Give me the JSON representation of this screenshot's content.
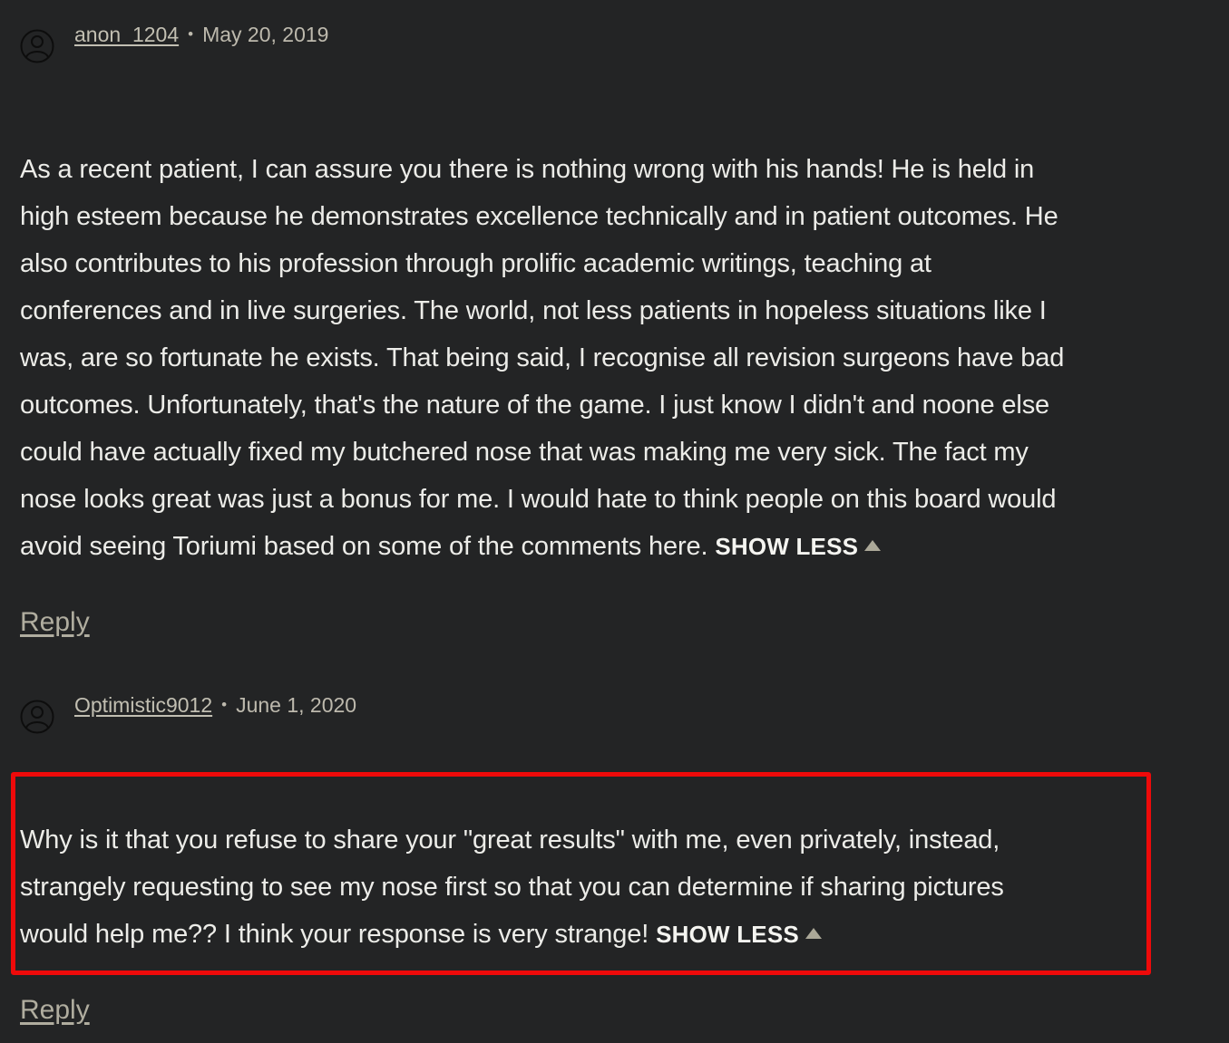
{
  "comments": [
    {
      "author": "anon_1204",
      "separator": "•",
      "date": "May 20, 2019",
      "lines": [
        "As a recent patient, I can assure you there is nothing wrong with his hands! He is held in",
        "high esteem because he demonstrates excellence technically and in patient outcomes. He",
        "also contributes to his profession through prolific academic writings, teaching at",
        "conferences and in live surgeries. The world, not less patients in hopeless situations like I",
        "was, are so fortunate he exists. That being said, I recognise all revision surgeons have bad",
        "outcomes. Unfortunately, that's the nature of the game. I just know I didn't and noone else",
        "could have actually fixed my butchered nose that was making me very sick. The fact my",
        "nose looks great was just a bonus for me. I would hate to think people on this board would",
        "avoid seeing Toriumi based on some of the comments here."
      ],
      "show_less_label": "SHOW LESS",
      "reply_label": "Reply"
    },
    {
      "author": "Optimistic9012",
      "separator": "•",
      "date": "June 1, 2020",
      "lines": [
        "Why is it that you refuse to share your \"great results\" with me, even privately, instead,",
        "strangely requesting to see my nose first so that you can determine if sharing pictures",
        "would help me?? I think your response is very strange!"
      ],
      "show_less_label": "SHOW LESS",
      "reply_label": "Reply"
    }
  ],
  "colors": {
    "background": "#232425",
    "text": "#ecece8",
    "meta": "#bdb9ad",
    "highlight": "#ee0a0a"
  },
  "icons": {
    "avatar": "user-avatar-icon",
    "show_less": "triangle-up-icon"
  }
}
